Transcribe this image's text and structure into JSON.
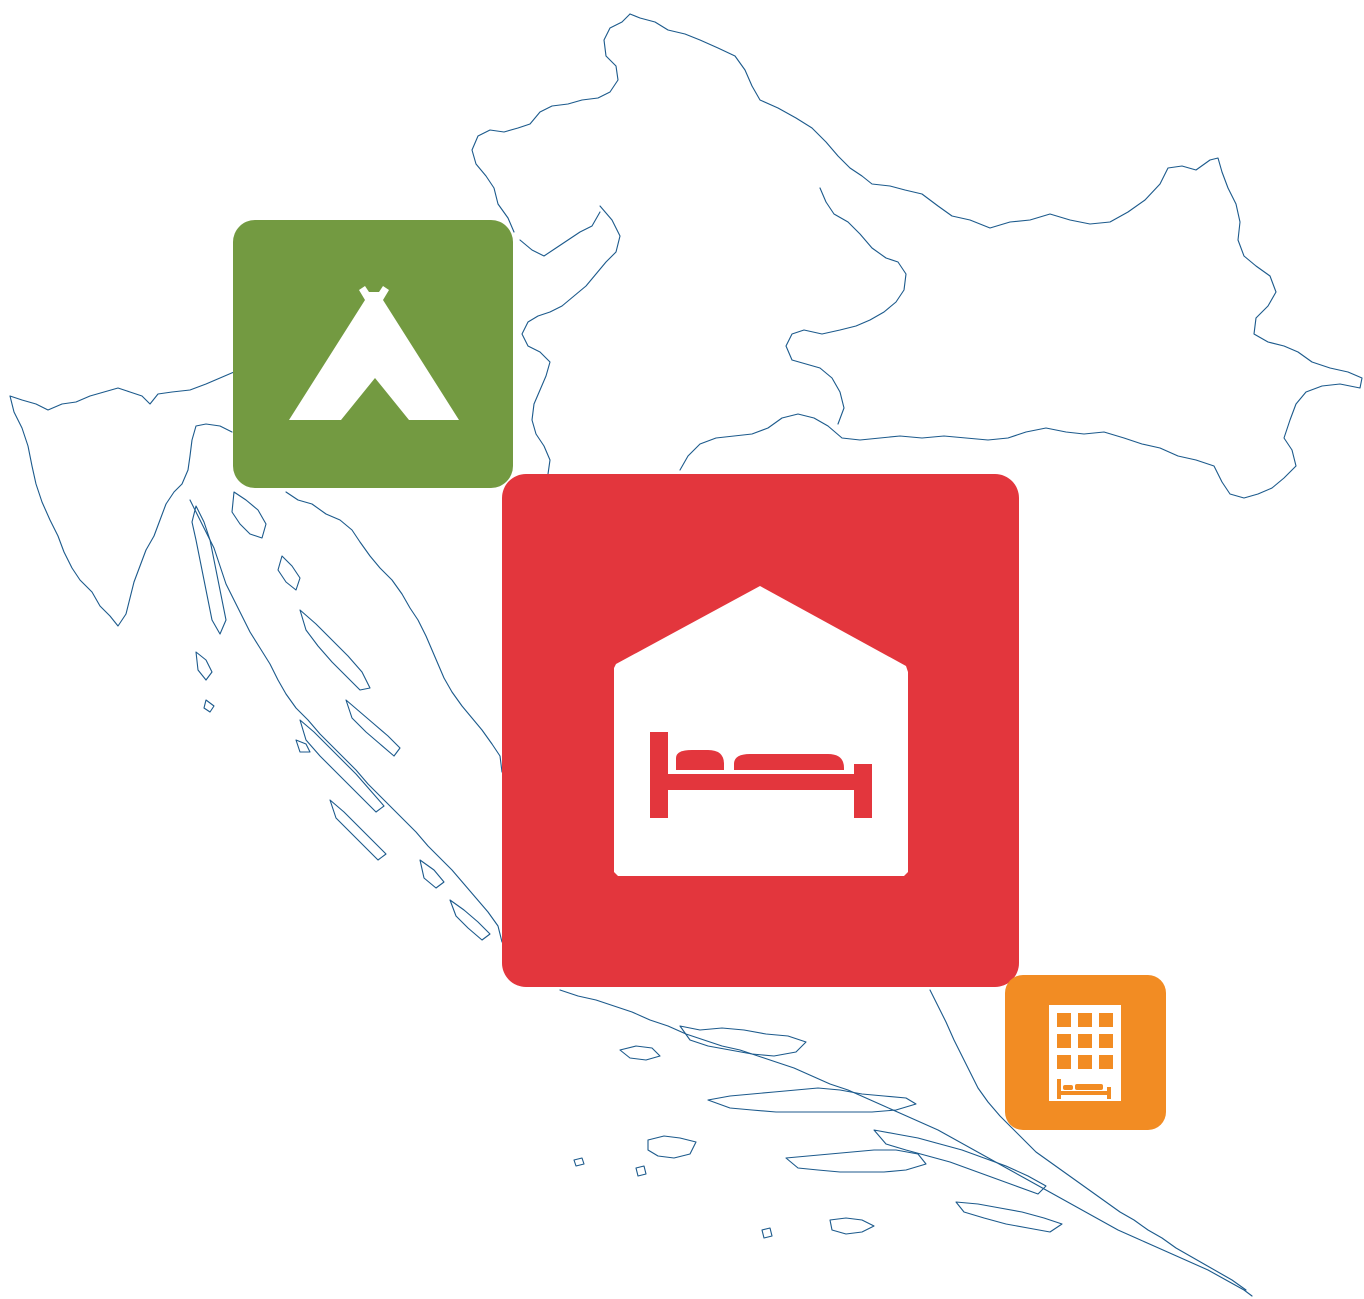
{
  "map": {
    "region": "Croatia",
    "style": "outline",
    "outline_color": "#1c5a8c",
    "background_color": "#ffffff"
  },
  "markers": [
    {
      "id": "camping",
      "icon": "tent-icon",
      "color": "#739a41"
    },
    {
      "id": "accommodation",
      "icon": "house-bed-icon",
      "color": "#e3363d"
    },
    {
      "id": "hotel",
      "icon": "hotel-building-icon",
      "color": "#f28c23"
    }
  ]
}
